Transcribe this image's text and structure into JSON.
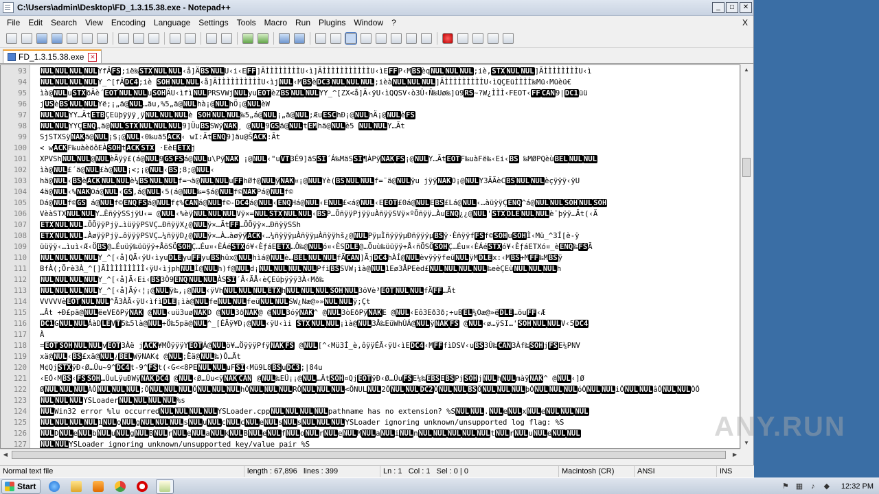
{
  "window": {
    "title": "C:\\Users\\admin\\Desktop\\FD_1.3.15.38.exe - Notepad++",
    "min": "_",
    "max": "□",
    "close": "✕"
  },
  "menu": [
    "File",
    "Edit",
    "Search",
    "View",
    "Encoding",
    "Language",
    "Settings",
    "Tools",
    "Macro",
    "Run",
    "Plugins",
    "Window",
    "?"
  ],
  "menu_close": "X",
  "tab": {
    "label": "FD_1.3.15.38.exe"
  },
  "editor": {
    "lines": [
      {
        "n": "93",
        "t": "<b>NUL</b><b>NUL</b><b>NUL</b><b>NUL</b>YfÄ<b>FS</b>;ië‰<b>STX</b><b>NUL</b><b>NUL</b>‹å]Ä<b>BS</b><b>NUL</b>U‹i‹E<b>FF</b>]ÃÌÌÌÌÌÌÌÌU‹ì]ÃÌÌÌÌÌÌÌÌÌÌÌU‹ìE<b>FF</b>P‹M<b>BS</b>èq<b>NUL</b><b>NUL</b><b>NUL</b>;iè,<b>STX</b><b>NUL</b><b>NUL</b>]ÃÌÌÌÌÌÌÌÌU‹ì"
      },
      {
        "n": "94",
        "t": "<b>NUL</b><b>NUL</b><b>NUL</b><b>NUL</b>Y_^[fÄ<b>DC4</b>;iè  <b>SOH</b><b>NUL</b><b>NUL</b>‹å]ÃÌÌÌÌÌÌÌÌÌÌU‹ìj<b>NUL</b>‹M<b>BS</b>è<b>DC3</b><b>NUL</b><b>NUL</b><b>NUL</b>;ièà<b>NUL</b><b>NUL</b><b>NUL</b>]ÃÌÌÌÌÌÌÌÌÌU‹ìQÇEüÌÌÌÌ‰Mü‹Müèü€"
      },
      {
        "n": "95",
        "t": "ìà@<b>NUL</b>u<b>STX</b>öÄè´<b>EOT</b><b>NUL</b><b>NUL</b>u<b>SOH</b>ÄU‹ìfì<b>NUL</b>PRSVWj<b>NUL</b>yu<b>EOT</b>èZ<b>BS</b><b>NUL</b><b>NUL</b>YY_^[ZX<å]Ã‹ÿU‹ìQQSV‹ò3Û‹Ñ‰Uø‰]ü9<b>RS</b>~?W¿ÌÌÌ‹FEOT‹<b>FF</b><b>CAN</b>9|<b>DC1</b>üü"
      },
      {
        "n": "96",
        "t": "j<b>US</b>è<b>BS</b><b>NUL</b><b>NUL</b>Yë;¡„ä@<b>NUL</b>…äu,%5„ä@<b>NUL</b>hà¡@<b>NUL</b>hÖ¡@<b>NUL</b>èW"
      },
      {
        "n": "97",
        "t": "<b>NUL</b><b>NUL</b>YY…Ãt<b>ETB</b>ÇEüþÿÿÿ¸ÿ<b>NUL</b><b>NUL</b><b>NUL</b>è  <b>SOH</b><b>NUL</b><b>NUL</b>‰5„á@<b>NUL</b>¡„ä@<b>NUL</b>;Æu<b>ESC</b>hÐ¡@<b>NUL</b>hÄ¡@<b>NUL</b>è<b>FS</b>"
      },
      {
        "n": "98",
        "t": "<b>NUL</b><b>NUL</b>YYÇ<b>ENQ</b>„ä@<b>NUL</b><b>STX</b><b>NUL</b><b>NUL</b><b>NUL</b>9]Üu<b>BS</b>SWÿ<b>NAK</b>¸ @<b>NUL</b>9<b>GS</b>ä@<b>NUL</b>t<b>EM</b>hä@<b>NUL</b>è5    <b>NUL</b><b>NUL</b>Y…Ãt"
      },
      {
        "n": "99",
        "t": "SjSTXSÿ<b>NAK</b>ä@<b>NUL</b>¡$¡@<b>NUL</b>‹0‰uä5<b>ACK</b>‹ wI:Ãt<b>ENQ</b>9]äu@Š<b>ACK</b>:Ãt"
      },
      {
        "n": "100",
        "t": "< w<b>ACK</b>F‰uàèöôEÀ<b>SOH</b>t<b>ACK</b><b>STX</b> ·EèE<b>ETX</b>j"
      },
      {
        "n": "101",
        "t": "XPVSh<b>NUL</b><b>NUL</b>@<b>NUL</b>èÃÿÿ£(á@<b>NUL</b>9<b>GS</b><b>FS</b>á@<b>NUL</b>u\\Pÿ<b>NAK</b>  ¡@<b>NUL</b>‹\"u<b>VT</b>3É9]äS<b>SI</b>´Á‰MäS<b>SI</b>¶ÀPÿ<b>NAK</b><b>FS</b>¡@<b>NUL</b>Y…Ãt<b>EOT</b>F‰uàFë‰‹Ei‹<b>BS</b>    ‰MØPQèù<b>BEL</b><b>NUL</b><b>NUL</b>"
      },
      {
        "n": "102",
        "t": "ìà@<b>NUL</b>£´ä@<b>NUL</b>£à@<b>NUL</b>¡<;¡@<b>NUL</b>‹<b>BS</b>;8;@<b>NUL</b>‹"
      },
      {
        "n": "103",
        "t": "hä@<b>NUL</b>‹<b>BS</b>è<b>ACK</b><b>NUL</b><b>NUL</b>è¼<b>BS</b><b>NUL</b><b>NUL</b>f=¬ä@<b>NUL</b><b>NUL</b>u<b>FF</b>hØ†@<b>NUL</b>ÿ<b>NAK</b>¤¡@<b>NUL</b>Yè(<b>BS</b><b>NUL</b><b>NUL</b>f=¨ä@<b>NUL</b>ÿu    jÿÿ<b>NAK</b>O¡@<b>NUL</b>Y3ÃÃèC<b>BS</b><b>NUL</b><b>NUL</b>èçÿÿÿ‹ÿU"
      },
      {
        "n": "104",
        "t": "4ä@<b>NUL</b>‹%<b>NAK</b>Oá@<b>NUL</b>‹<b>GS</b>,á@<b>NUL</b>‹5(á@<b>NUL</b>‰=$á@<b>NUL</b>f©<b>NAK</b>Pá@<b>NUL</b>f©"
      },
      {
        "n": "105",
        "t": "Dá@<b>NUL</b>f©<b>GS</b> á@<b>NUL</b>f©<b>ENQ</b><b>FS</b>á@<b>NUL</b>f¢%<b>CAN</b>á@<b>NUL</b>f©-<b>DC4</b>á@<b>NUL</b>‹<b>ENQ</b>Há@<b>NUL</b>‹E<b>NUL</b>£<á@<b>NUL</b>‹E<b>EOT</b>£0á@<b>NUL</b>E<b>BS</b>£Lá@<b>NUL</b>‹…àüÿÿÇ<b>ENQ</b>^á@<b>NUL</b><b>NUL</b><b>SOH</b><b>NUL</b><b>SOH</b>"
      },
      {
        "n": "106",
        "t": "VèàSTX<b>NUL</b><b>NUL</b>Y…ÈñÿÿSSjÿU‹= @<b>NUL</b>‹%èÿ<b>NUL</b><b>NUL</b><b>NUL</b>Vÿ×=<b>NUL</b><b>STX</b><b>NUL</b><b>NUL</b>‹<b>BS</b>P…ÕñÿÿPjÿÿuÀñÿÿSVÿ×ºÕñÿÿ…Àu<b>ENQ</b>¿¿@<b>NUL</b>'<b>STX</b><b>DLE</b><b>NUL</b><b>NUL</b>è¯þÿÿ…Ãt(‹Ä"
      },
      {
        "n": "107",
        "t": "<b>ETX</b><b>NUL</b><b>NUL</b>…ÕÕÿÿPjÿ…ìüÿÿPSVÇ…ÐñÿÿX¿@<b>NUL</b>ÿ×…Ãt<b>FF</b>…ÕÕÿÿ×…ÐñÿÿSSh"
      },
      {
        "n": "108",
        "t": "<b>ETX</b><b>NUL</b><b>NUL</b>…ÀøÿÿPjÿ…ôÿÿÿPSVÇ…¼ñÿÿD¿@<b>NUL</b>ÿ×…À…àøÿÿ<b>ACK</b>‹…¼ñÿÿÿµÀñÿÿµÀñÿÿhš¿@<b>NUL</b>PÿµÌñÿÿÿµÐñÿÿÿµ<b>BS</b>ÿ·Èñÿÿf<b>FS</b>f©<b>SOH</b>u<b>SOH</b>Ì‹Mü_^3Í[è-ÿ"
      },
      {
        "n": "109",
        "t": "üüÿÿ‹…ìuì‹Æ‹Ö<b>BS</b>@…Éuüÿ‰üüÿÿ+ÅõSÖ<b>SOH</b>Ç…Éu¤‹ÈÁé<b>STX</b>ó¥‹ÈƒáE<b>ETX</b>…Ô‰@<b>NUL</b>ó¤‹ÈS<b>DLE</b>@…Õuù‰üüÿÿ+Å‹ñÕSÖ<b>SOH</b>Ç…Éu¤‹ÈÁé<b>STX</b>ó¥‹ÈƒáETXó¤_è<b>ENQ</b>‰<b>FS</b>Ã"
      },
      {
        "n": "110",
        "t": "<b>NUL</b><b>NUL</b><b>NUL</b><b>NUL</b>Y_^[‹å]QÄ‹ÿU‹ìyu<b>DLE</b>yu<b>FF</b>yu<b>BS</b>hüx@<b>NUL</b>hìá@<b>NUL</b>è…<b>BEL</b><b>NUL</b><b>NUL</b>fÄ<b>CAN</b>]Ãj<b>DC4</b>hÀÍ@<b>NUL</b>èvÿÿÿfeü<b>NUL</b>ÿM<b>DLE</b>x:‹M<b>BS</b>+M<b>FF</b>‰M<b>BS</b>ÿ"
      },
      {
        "n": "111",
        "t": "BfÀ(;Örè3À_^[]ÃÌÌÌÌÌÌÌÌÌ‹ÿU‹ìjph<b>NUL</b>Ì@<b>NUL</b>h)f@<b>NUL</b>d¡<b>NUL</b><b>NUL</b><b>NUL</b><b>NUL</b>Pfì<b>BS</b>SVW¡ìà@<b>NUL</b>1Eø3ÅPEèd£<b>NUL</b><b>NUL</b><b>NUL</b><b>NUL</b>‰eèÇEü<b>NUL</b><b>NUL</b><b>NUL</b>h"
      },
      {
        "n": "112",
        "t": "<b>NUL</b><b>NUL</b><b>NUL</b><b>NUL</b>Y_^[‹å]Ã‹Ei‹<b>BS</b>3Ò9<b>ENQ</b><b>NUL</b><b>NUL</b>ÀS<b>SI</b>´Â‹ÃÅ‹èÇEüþÿÿÿ3À‹Mð‰"
      },
      {
        "n": "113",
        "t": "<b>NUL</b><b>NUL</b><b>NUL</b><b>NUL</b>Y_^[‹å]Ãý‹¦¡@<b>NUL</b>ÿ‰,¡@<b>NUL</b>‹ÿVh<b>NUL</b><b>NUL</b><b>NUL</b><b>ETX</b>h<b>NUL</b><b>NUL</b><b>NUL</b><b>SOH</b><b>NUL</b>3öVè³<b>EOT</b><b>NUL</b><b>NUL</b>fÄ<b>FF</b>…Ãt"
      },
      {
        "n": "114",
        "t": "VVVVVè<b>EOT</b><b>NUL</b><b>NUL</b>^Ã3ÀÃ‹ÿU‹ìfì<b>DLE</b>¡ìà@<b>NUL</b>fe<b>NUL</b><b>NUL</b>feü<b>NUL</b><b>NUL</b>SW¿Næ@»»<b>NUL</b><b>NUL</b>ÿ;Çt"
      },
      {
        "n": "115",
        "t": "…Ât ÷Ð£pä@<b>NUL</b>ëeVEðPÿ<b>NAK</b>  @<b>NUL</b>‹uü3uø<b>NAK</b>D @<b>NUL</b>3ð<b>NAK</b>@ @<b>NUL</b>3óÿ<b>NAK</b>^ @<b>NUL</b>3òEðPÿ<b>NAK</b>E @<b>NUL</b>‹Eô3Eð3ð;÷uB<b>EL</b>¼Oæ@»ë<b>DLE</b>…öu<b>FF</b>‹Æ"
      },
      {
        "n": "116",
        "t": "<b>DC1</b>G<b>NUL</b><b>NUL</b>ÁàD<b>LE</b>V<b>T</b>5‰5là@<b>NUL</b>÷Ö‰5pä@<b>NUL</b>^_[ÉÃÿ¥D¡@<b>NUL</b>‹ÿU‹ìi  <b>STX</b><b>NUL</b><b>NUL</b>¡ìà@<b>NUL</b>3Å‰EüWhÚÁ@<b>NUL</b>ÿ<b>NAK</b><b>FS</b> @<b>NUL</b>‹ø…ÿSI…'<b>SOH</b><b>NUL</b><b>NUL</b>V‹5<b>DC4</b>"
      },
      {
        "n": "117",
        "t": "À"
      },
      {
        "n": "118",
        "t": "=<b>EOT</b><b>SOH</b><b>NUL</b><b>NUL</b>v<b>EOT</b>3Àë j<b>ACK</b>¥MÔÿÿÿY<b>EOT</b>Á@<b>NUL</b>ö¥…ÖÿÿÿPfÿ<b>NAK</b><b>FS</b>  @<b>NUL</b>[^‹Mü3Í_è,ôÿÿÉÃ‹ÿU‹ìE<b>DC4</b>‹M<b>FF</b>fìDSV‹u<b>BS</b>3Û‰<b>CAN</b>3Àf‰<b>SOH</b>j<b>FS</b>E¼PNV"
      },
      {
        "n": "119",
        "t": "xä@<b>NUL</b>‹<b>BS</b>£xä@<b>NUL</b>¿<b>BEL</b>WÿNAK¢ @<b>NUL</b>;Ëä@<b>NUL</b>‰)Ô…Ãt"
      },
      {
        "n": "120",
        "t": "M¢Qj<b>STX</b>ÿÐ‹Ø…Ûu~9^<b>DC4</b>t-9^<b>FS</b>t(‹G<<8PE<b>NUL</b><b>NUL</b>uF<b>SI</b>‹Mü9L8<b>BS</b>u<b>DC3</b>;|84u"
      },
      {
        "n": "121",
        "t": "‹EÓ‹M<b>BS</b>‹<b>FS</b><b>SOH</b>…ÛuLÿuÐWÿ<b>NAK</b><b>DC4</b> @<b>NUL</b>‹Ø…Ûu<ÿ<b>NAK</b><b>CAN</b> @<b>NUL</b>‰EÜ¡¡@<b>NUL</b>…Ãt<b>SOH</b>¤Qj<b>EOT</b>ÿÐ‹Ø…Ûu<b>FS</b>E¼‰<b>EBS</b>E<b>BS</b>Pj<b>SOH</b>j<b>NUL</b>h<b>NUL</b>màÿ<b>NAK</b>^ @<b>NUL</b>‹]Ø"
      },
      {
        "n": "122",
        "t": "Ø<b>NUL</b><b>NUL</b><b>NUL</b>ÀÕ<b>NUL</b><b>NUL</b><b>NUL</b>;Õ<b>NUL</b><b>NUL</b><b>NUL</b>Õ<b>NUL</b><b>NUL</b><b>NUL</b>hÕ<b>NUL</b><b>NUL</b><b>NUL</b>RÕ<b>NUL</b><b>NUL</b><b>NUL</b><ÕNUL<b>NUL</b>2Õ<b>NUL</b><b>NUL</b><b>DC2</b>Õ<b>NUL</b><b>NUL</b><b>BS</b>Õ<b>NUL</b><b>NUL</b><b>NUL</b>þÔ<b>NUL</b><b>NUL</b><b>NUL</b>óÔ<b>NUL</b><b>NUL</b>iÔ<b>NUL</b><b>NUL</b>âÔ<b>NUL</b><b>NUL</b>ÒÔ"
      },
      {
        "n": "123",
        "t": "<b>NUL</b><b>NUL</b><b>NUL</b>YSLoader<b>NUL</b><b>NUL</b><b>NUL</b><b>NUL</b>%s"
      },
      {
        "n": "124",
        "t": "<b>NUL</b>Win32 error %lu occurred<b>NUL</b><b>NUL</b><b>NUL</b><b>NUL</b>YSLoader.cpp<b>NUL</b><b>NUL</b><b>NUL</b><b>NUL</b>pathname has no extension? %S<b>NUL</b><b>NUL</b>.<b>NUL</b>e<b>NUL</b>x<b>NUL</b>e<b>NUL</b><b>NUL</b><b>NUL</b>"
      },
      {
        "n": "125",
        "t": "<b>NUL</b><b>NUL</b><b>NUL</b><b>NUL</b>1<b>NUL</b>o<b>NUL</b>g<b>NUL</b><b>NUL</b><b>NUL</b>s<b>NUL</b>u<b>NUL</b>c<b>NUL</b>c<b>NUL</b>e<b>NUL</b>s<b>NUL</b>s<b>NUL</b><b>NUL</b><b>NUL</b>YSLoader ignoring unknown/unsupported log flag: %S"
      },
      {
        "n": "126",
        "t": "<b>NUL</b>D<b>NUL</b>e<b>NUL</b>b<b>NUL</b>u<b>NUL</b>g<b>NUL</b>B<b>NUL</b>r<b>NUL</b>e<b>NUL</b>a<b>NUL</b>k<b>NUL</b>B<b>NUL</b>e<b>NUL</b>f<b>NUL</b>o<b>NUL</b>r<b>NUL</b>e<b>NUL</b>M<b>NUL</b>a<b>NUL</b>i<b>NUL</b>n<b>NUL</b><b>NUL</b><b>NUL</b><b>NUL</b><b>NUL</b>t<b>NUL</b>r<b>NUL</b>u<b>NUL</b>e<b>NUL</b><b>NUL</b>"
      },
      {
        "n": "127",
        "t": "<b>NUL</b><b>NUL</b>YSLoader ignoring unknown/unsupported key/value pair %S"
      }
    ]
  },
  "status": {
    "type": "Normal text file",
    "length": "length : 67,896",
    "lines": "lines : 399",
    "ln": "Ln : 1",
    "col": "Col : 1",
    "sel": "Sel : 0 | 0",
    "eol": "Macintosh (CR)",
    "encoding": "ANSI",
    "mode": "INS"
  },
  "watermark": "ANY.RUN",
  "taskbar": {
    "start": "Start",
    "clock": "12:32 PM"
  }
}
